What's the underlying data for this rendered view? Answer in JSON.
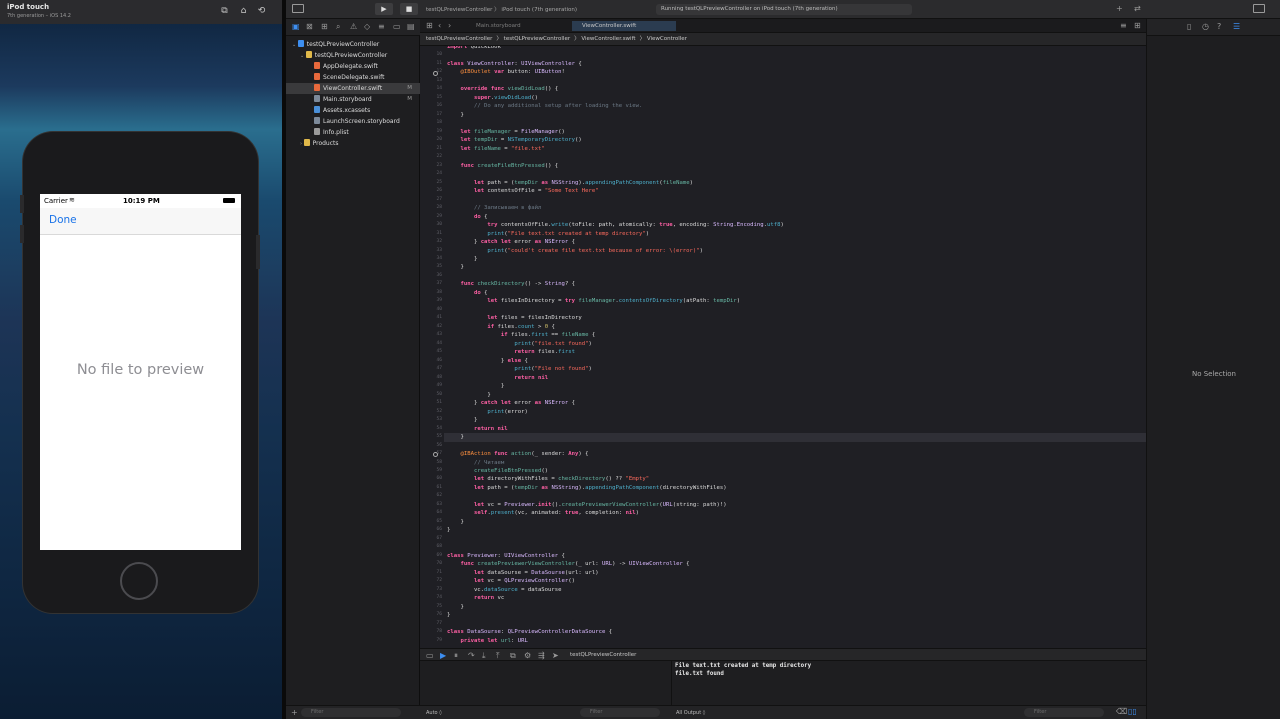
{
  "simulator": {
    "device": "iPod touch",
    "os": "7th generation – iOS 14.2",
    "status_carrier": "Carrier",
    "status_time": "10:19 PM",
    "nav_done": "Done",
    "placeholder_text": "No file to preview"
  },
  "toolbar": {
    "scheme": "testQLPreviewController 〉 iPod touch (7th generation)",
    "activity": "Running testQLPreviewController on iPod touch (7th generation)"
  },
  "navigator": {
    "items": [
      {
        "label": "testQLPreviewController",
        "badge": ""
      },
      {
        "label": "testQLPreviewController",
        "badge": ""
      },
      {
        "label": "AppDelegate.swift",
        "badge": ""
      },
      {
        "label": "SceneDelegate.swift",
        "badge": ""
      },
      {
        "label": "ViewController.swift",
        "badge": "M"
      },
      {
        "label": "Main.storyboard",
        "badge": "M"
      },
      {
        "label": "Assets.xcassets",
        "badge": ""
      },
      {
        "label": "LaunchScreen.storyboard",
        "badge": ""
      },
      {
        "label": "Info.plist",
        "badge": ""
      },
      {
        "label": "Products",
        "badge": ""
      }
    ],
    "filter_placeholder": "Filter"
  },
  "editor": {
    "tabs": [
      "Main.storyboard",
      "ViewController.swift"
    ],
    "jumpbar": [
      "testQLPreviewController",
      "testQLPreviewController",
      "ViewController.swift",
      "ViewController"
    ],
    "line_numbers": [
      "",
      "10",
      "11",
      "12",
      "13",
      "14",
      "15",
      "16",
      "17",
      "18",
      "19",
      "20",
      "21",
      "22",
      "23",
      "24",
      "25",
      "26",
      "27",
      "28",
      "29",
      "30",
      "31",
      "32",
      "33",
      "34",
      "35",
      "36",
      "37",
      "38",
      "39",
      "40",
      "41",
      "42",
      "43",
      "44",
      "45",
      "46",
      "47",
      "48",
      "49",
      "50",
      "51",
      "52",
      "53",
      "54",
      "55",
      "56",
      "57",
      "58",
      "59",
      "60",
      "61",
      "62",
      "63",
      "64",
      "65",
      "66",
      "67",
      "68",
      "69",
      "70",
      "71",
      "72",
      "73",
      "74",
      "75",
      "76",
      "77",
      "78",
      "79"
    ]
  },
  "debug": {
    "target": "testQLPreviewController",
    "console_lines": [
      "File text.txt created at temp directory",
      "file.txt found"
    ],
    "auto_label": "Auto ◊",
    "filter_placeholder": "Filter",
    "all_output": "All Output ◊"
  },
  "inspector": {
    "no_selection": "No Selection"
  }
}
